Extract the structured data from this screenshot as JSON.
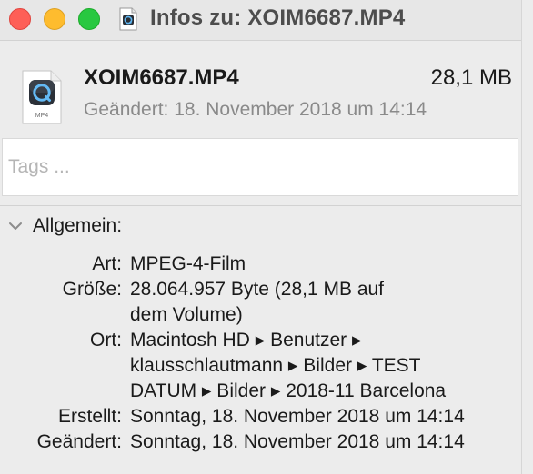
{
  "window": {
    "title": "Infos zu: XOIM6687.MP4"
  },
  "header": {
    "file_name": "XOIM6687.MP4",
    "file_size": "28,1 MB",
    "modified": "Geändert: 18. November 2018 um 14:14",
    "file_icon": "quicktime-mp4-file-icon",
    "file_icon_caption": "MP4"
  },
  "tags": {
    "placeholder": "Tags ...",
    "value": ""
  },
  "general": {
    "section_title": "Allgemein:",
    "expanded": true,
    "rows": [
      {
        "label": "Art:",
        "lines": [
          "MPEG-4-Film"
        ]
      },
      {
        "label": "Größe:",
        "lines": [
          "28.064.957 Byte (28,1 MB auf",
          "dem Volume)"
        ]
      },
      {
        "label": "Ort:",
        "lines": [
          "Macintosh HD ▸ Benutzer ▸",
          "klausschlautmann ▸ Bilder ▸ TEST",
          "DATUM ▸ Bilder ▸ 2018-11 Barcelona"
        ]
      },
      {
        "label": "Erstellt:",
        "lines": [
          "Sonntag, 18. November 2018 um 14:14"
        ]
      },
      {
        "label": "Geändert:",
        "lines": [
          "Sonntag, 18. November 2018 um 14:14"
        ]
      }
    ]
  },
  "colors": {
    "close": "#fe5f57",
    "minimize": "#febc2e",
    "maximize": "#28c840",
    "window_bg": "#ececec",
    "secondary_text": "#8a8a8a"
  }
}
